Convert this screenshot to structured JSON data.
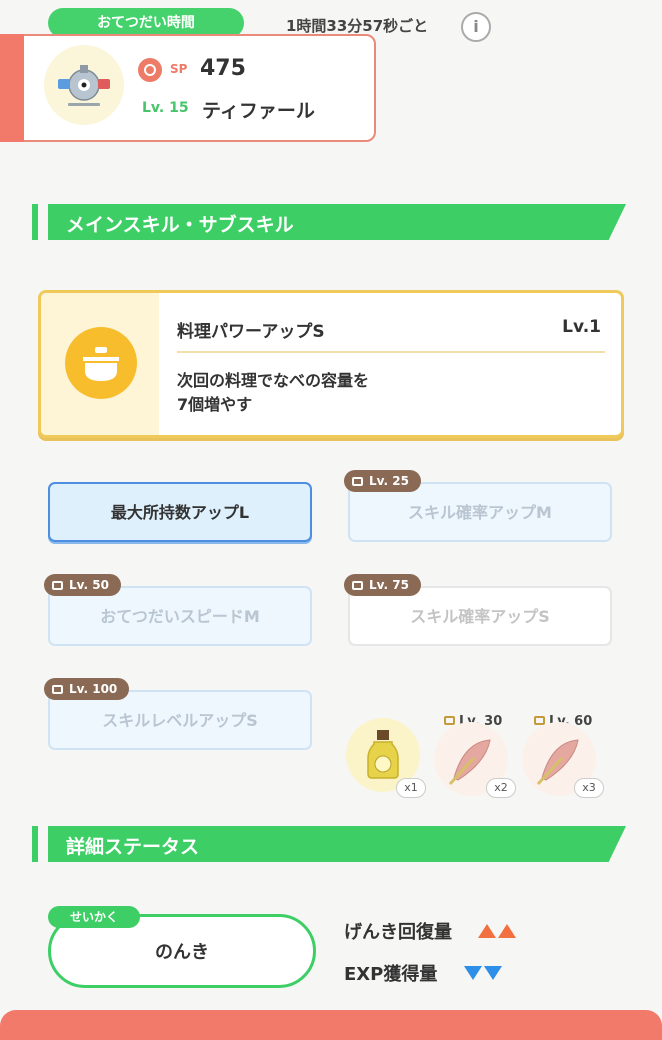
{
  "header": {
    "help_time_label": "おてつだい時間",
    "help_time_value": "1時間33分57秒ごと",
    "info_label": "i"
  },
  "pokemon": {
    "sp_label": "SP",
    "sp_value": "475",
    "level": "Lv. 15",
    "name": "ティファール"
  },
  "sections": {
    "skills": "メインスキル・サブスキル",
    "status": "詳細ステータス"
  },
  "main_skill": {
    "name": "料理パワーアップS",
    "level": "Lv.1",
    "desc_line1": "次回の料理でなべの容量を",
    "desc_line2": "7個増やす"
  },
  "sub_skills": [
    {
      "label": "最大所持数アップL",
      "unlock": ""
    },
    {
      "label": "スキル確率アップM",
      "unlock": "Lv. 25"
    },
    {
      "label": "おてつだいスピードM",
      "unlock": "Lv. 50"
    },
    {
      "label": "スキル確率アップS",
      "unlock": "Lv. 75"
    },
    {
      "label": "スキルレベルアップS",
      "unlock": "Lv. 100"
    }
  ],
  "ingredients": [
    {
      "icon": "oil-bottle-icon",
      "count": "x1",
      "unlock": ""
    },
    {
      "icon": "herb-leaf-icon",
      "count": "x2",
      "unlock": "Lv. 30"
    },
    {
      "icon": "herb-leaf-icon",
      "count": "x3",
      "unlock": "Lv. 60"
    }
  ],
  "nature": {
    "tag": "せいかく",
    "value": "のんき",
    "stat_up": "げんき回復量",
    "stat_down": "EXP獲得量"
  },
  "colors": {
    "accent_green": "#3dcf66",
    "sp_red": "#ee7b68",
    "up_orange": "#f2703f",
    "down_blue": "#2f8ee8"
  }
}
